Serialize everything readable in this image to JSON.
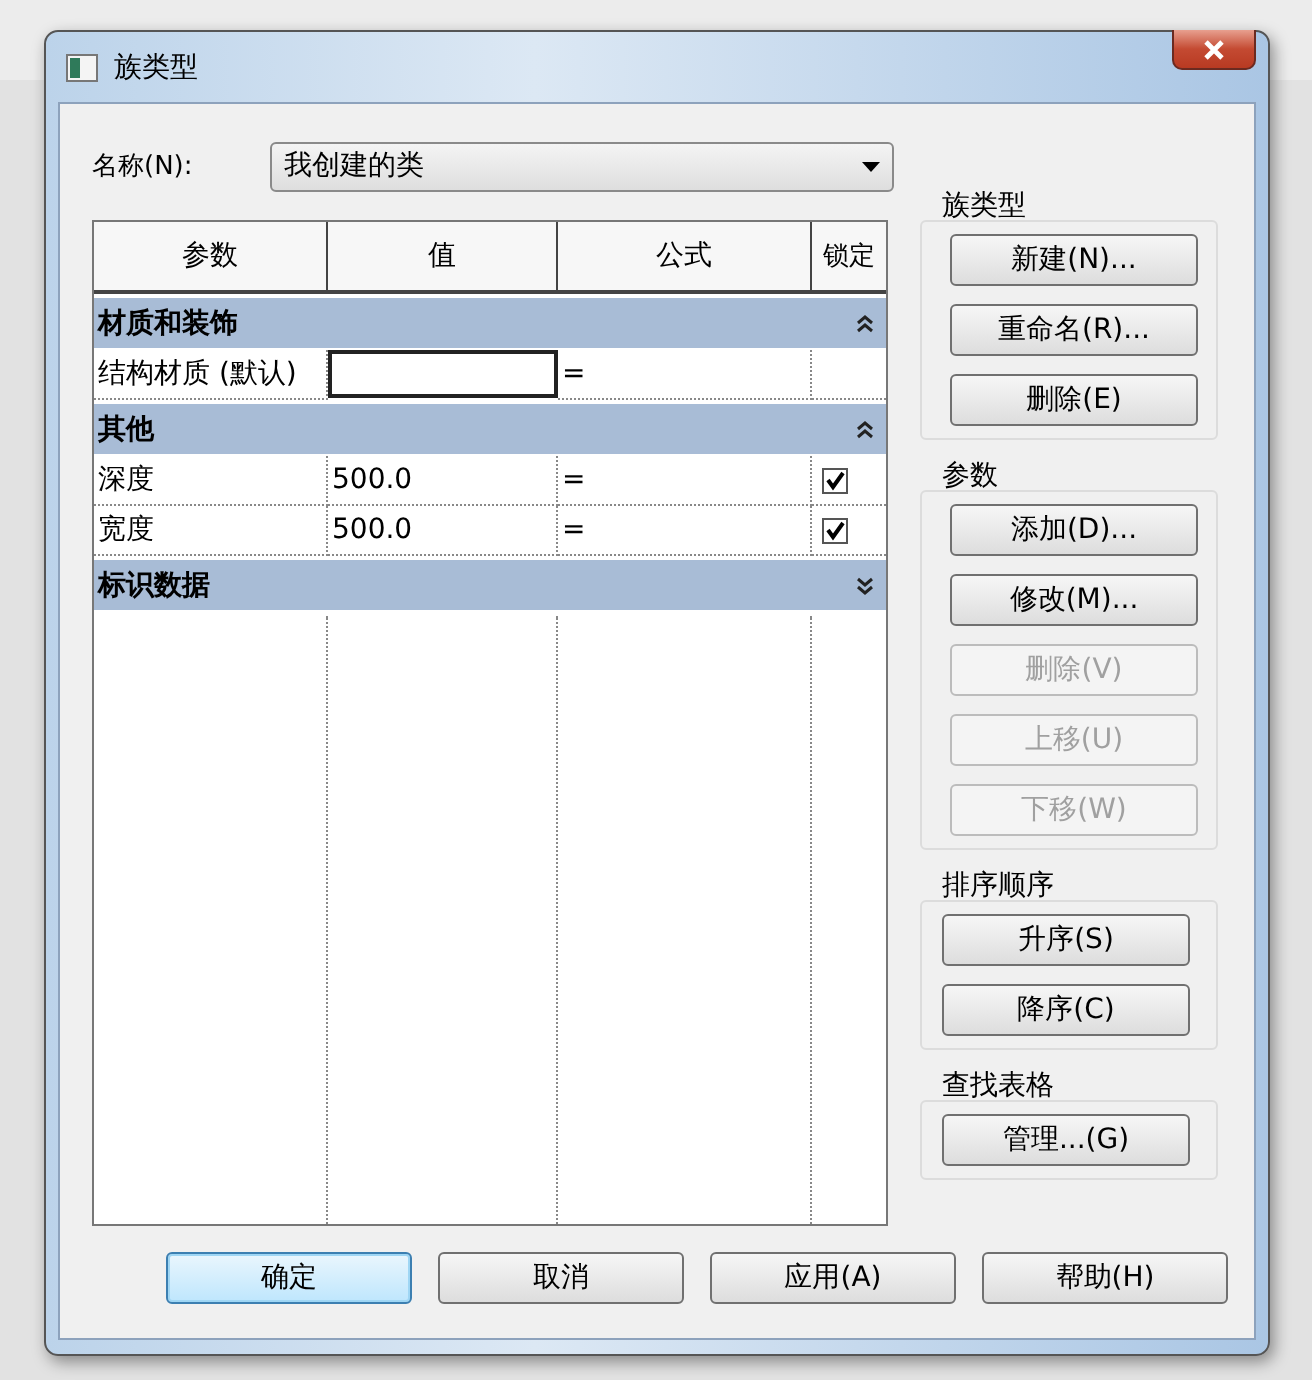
{
  "window": {
    "title": "族类型"
  },
  "name_field": {
    "label": "名称(N):",
    "value": "我创建的类"
  },
  "table": {
    "columns": [
      "参数",
      "值",
      "公式",
      "锁定"
    ],
    "groups": [
      {
        "title": "材质和装饰",
        "expanded": true,
        "rows": [
          {
            "parameter": "结构材质 (默认)",
            "value": "",
            "formula": "=",
            "focused": true
          }
        ]
      },
      {
        "title": "其他",
        "expanded": true,
        "rows": [
          {
            "parameter": "深度",
            "value": "500.0",
            "formula": "=",
            "focused": false,
            "locked": true
          },
          {
            "parameter": "宽度",
            "value": "500.0",
            "formula": "=",
            "focused": false,
            "locked": true
          }
        ]
      },
      {
        "title": "标识数据",
        "expanded": false
      }
    ]
  },
  "side_groups": [
    {
      "title": "族类型",
      "buttons": [
        {
          "label": "新建(N)...",
          "disabled": false
        },
        {
          "label": "重命名(R)...",
          "disabled": false
        },
        {
          "label": "删除(E)",
          "disabled": false
        }
      ]
    },
    {
      "title": "参数",
      "buttons": [
        {
          "label": "添加(D)...",
          "disabled": false
        },
        {
          "label": "修改(M)...",
          "disabled": false
        },
        {
          "label": "删除(V)",
          "disabled": true
        },
        {
          "label": "上移(U)",
          "disabled": true
        },
        {
          "label": "下移(W)",
          "disabled": true
        }
      ]
    },
    {
      "title": "排序顺序",
      "buttons": [
        {
          "label": "升序(S)",
          "disabled": false
        },
        {
          "label": "降序(C)",
          "disabled": false
        }
      ]
    },
    {
      "title": "查找表格",
      "buttons": [
        {
          "label": "管理...(G)",
          "disabled": false
        }
      ]
    }
  ],
  "buttons": [
    {
      "label": "确定",
      "default": true
    },
    {
      "label": "取消",
      "default": false
    },
    {
      "label": "应用(A)",
      "default": false
    },
    {
      "label": "帮助(H)",
      "default": false
    }
  ]
}
